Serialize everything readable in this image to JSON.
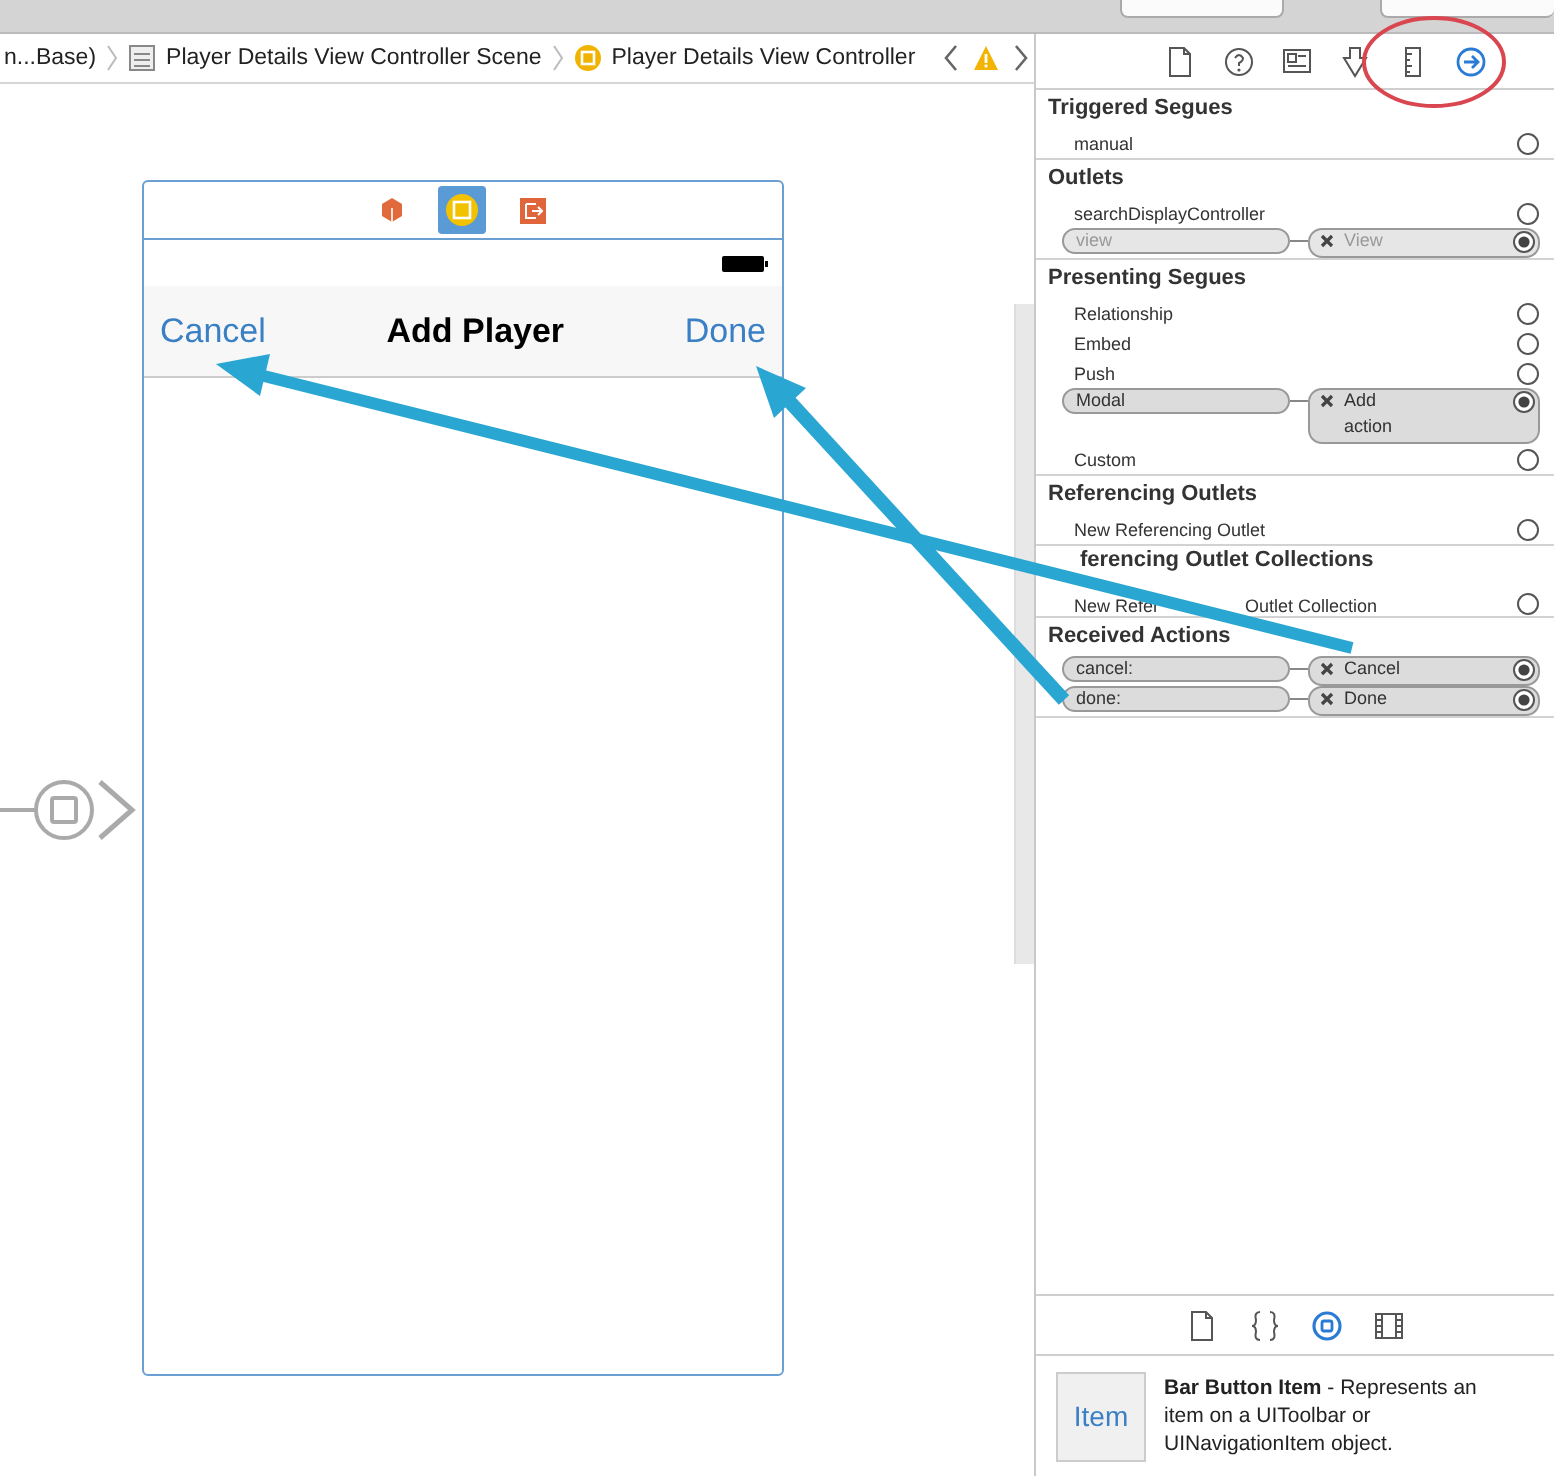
{
  "breadcrumb": [
    {
      "kind": "text",
      "label": "n...Base)"
    },
    {
      "kind": "scene",
      "label": "Player Details View Controller Scene"
    },
    {
      "kind": "controller",
      "label": "Player Details View Controller"
    }
  ],
  "scene": {
    "nav_left": "Cancel",
    "nav_title": "Add Player",
    "nav_right": "Done"
  },
  "inspector_tabs": [
    {
      "kind": "file",
      "selected": false
    },
    {
      "kind": "help",
      "selected": false
    },
    {
      "kind": "identity",
      "selected": false
    },
    {
      "kind": "attributes",
      "selected": false
    },
    {
      "kind": "size",
      "selected": false
    },
    {
      "kind": "connections",
      "selected": true
    }
  ],
  "sections": [
    {
      "title": "Triggered Segues",
      "rows": [
        {
          "label": "manual",
          "connected": false
        }
      ]
    },
    {
      "title": "Outlets",
      "rows": [
        {
          "label": "searchDisplayController",
          "connected": false
        },
        {
          "label": "view",
          "connected": true,
          "target": "View",
          "dimmed": true
        }
      ]
    },
    {
      "title": "Presenting Segues",
      "rows": [
        {
          "label": "Relationship",
          "connected": false
        },
        {
          "label": "Embed",
          "connected": false
        },
        {
          "label": "Push",
          "connected": false
        },
        {
          "label": "Modal",
          "connected": true,
          "target": "Add action",
          "dimmed": false
        },
        {
          "label": "Custom",
          "connected": false
        }
      ]
    },
    {
      "title": "Referencing Outlets",
      "rows": [
        {
          "label": "New Referencing Outlet",
          "connected": false
        }
      ]
    },
    {
      "title": "ferencing Outlet Collections",
      "covered_start": true,
      "rows": [
        {
          "label": "New Refer",
          "label_after_cover": "Outlet Collection",
          "connected": false
        }
      ]
    },
    {
      "title": "Received Actions",
      "rows": [
        {
          "label": "cancel:",
          "connected": true,
          "target": "Cancel",
          "dimmed": false
        },
        {
          "label": "done:",
          "connected": true,
          "target": "Done",
          "dimmed": false
        }
      ]
    }
  ],
  "library_tabs": [
    {
      "kind": "file",
      "selected": false
    },
    {
      "kind": "braces",
      "selected": false
    },
    {
      "kind": "object",
      "selected": true
    },
    {
      "kind": "media",
      "selected": false
    }
  ],
  "library_item": {
    "thumb": "Item",
    "description": "**Bar Button Item** - Represents an item on a UIToolbar or UINavigationItem object."
  }
}
